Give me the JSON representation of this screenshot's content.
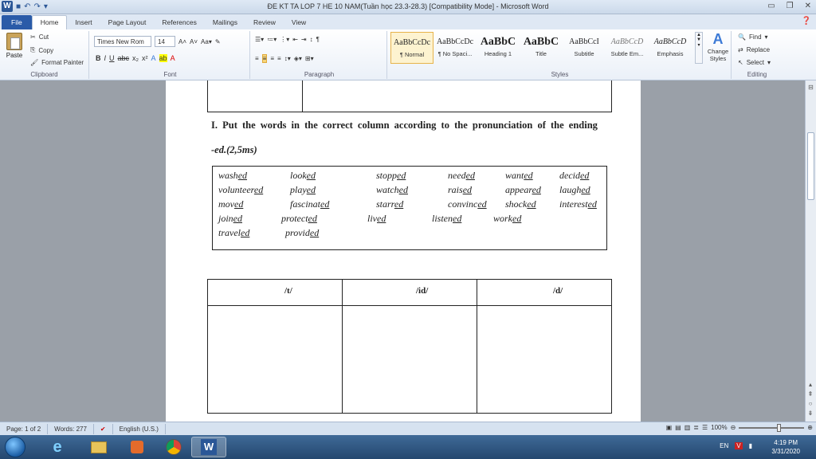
{
  "window": {
    "title": "ĐE KT TA LOP 7 HE 10 NAM(Tuần học 23.3-28.3) [Compatibility Mode] - Microsoft Word"
  },
  "ribbon": {
    "tabs": [
      "File",
      "Home",
      "Insert",
      "Page Layout",
      "References",
      "Mailings",
      "Review",
      "View"
    ],
    "active_tab": "Home",
    "clipboard": {
      "paste": "Paste",
      "cut": "Cut",
      "copy": "Copy",
      "format_painter": "Format Painter",
      "label": "Clipboard"
    },
    "font": {
      "name": "Times New Rom",
      "size": "14",
      "label": "Font"
    },
    "paragraph": {
      "label": "Paragraph"
    },
    "styles": {
      "label": "Styles",
      "items": [
        {
          "sample": "AaBbCcDc",
          "name": "¶ Normal"
        },
        {
          "sample": "AaBbCcDc",
          "name": "¶ No Spaci..."
        },
        {
          "sample": "AaBbC",
          "name": "Heading 1"
        },
        {
          "sample": "AaBbC",
          "name": "Title"
        },
        {
          "sample": "AaBbCcI",
          "name": "Subtitle"
        },
        {
          "sample": "AaBbCcD",
          "name": "Subtle Em..."
        },
        {
          "sample": "AaBbCcD",
          "name": "Emphasis"
        }
      ],
      "change_styles": "Change Styles"
    },
    "editing": {
      "find": "Find",
      "replace": "Replace",
      "select": "Select",
      "label": "Editing"
    }
  },
  "document": {
    "heading": "I. Put the words in the correct column according to the pronunciation of the ending",
    "subheading": "-ed.(2,5ms)",
    "word_rows": [
      [
        [
          "wash",
          "ed"
        ],
        [
          "look",
          "ed"
        ],
        [
          "stopp",
          "ed"
        ],
        [
          "need",
          "ed"
        ],
        [
          "want",
          "ed"
        ],
        [
          "decid",
          "ed"
        ]
      ],
      [
        [
          "volunteer",
          "ed"
        ],
        [
          "play",
          "ed"
        ],
        [
          "watch",
          "ed"
        ],
        [
          "rais",
          "ed"
        ],
        [
          "appear",
          "ed"
        ],
        [
          "laugh",
          "ed"
        ]
      ],
      [
        [
          "mov",
          "ed"
        ],
        [
          "fascinat",
          "ed"
        ],
        [
          "starr",
          "ed"
        ],
        [
          "convinc",
          "ed"
        ],
        [
          "shock",
          "ed"
        ],
        [
          "interest",
          "ed"
        ]
      ],
      [
        [
          "join",
          "ed"
        ],
        [
          "protect",
          "ed"
        ],
        [
          "liv",
          "ed"
        ],
        [
          "listen",
          "ed"
        ],
        [
          "work",
          "ed"
        ]
      ],
      [
        [
          "travel",
          "ed"
        ],
        [
          "provid",
          "ed"
        ]
      ]
    ],
    "table_headers": [
      "/t/",
      "/id/",
      "/d/"
    ]
  },
  "status": {
    "page": "Page: 1 of 2",
    "words": "Words: 277",
    "language": "English (U.S.)",
    "zoom": "100%"
  },
  "taskbar": {
    "lang": "EN",
    "time": "4:19 PM",
    "date": "3/31/2020"
  }
}
